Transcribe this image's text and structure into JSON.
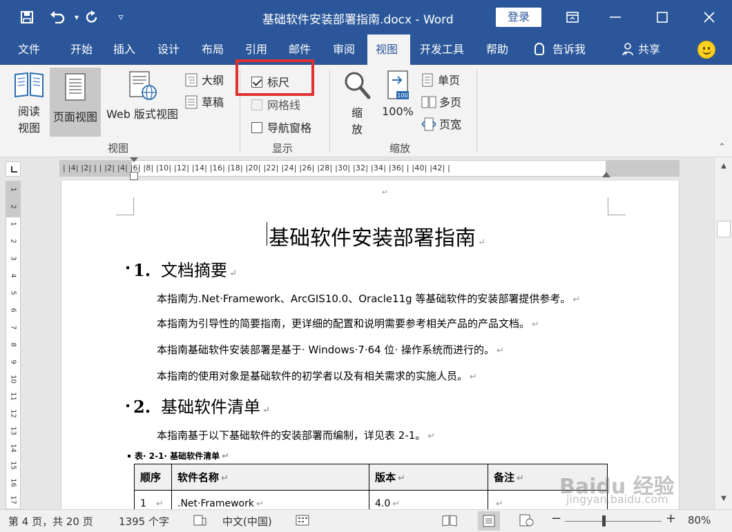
{
  "titlebar": {
    "doc_title": "基础软件安装部署指南.docx  -  Word",
    "login": "登录",
    "save_icon": "save-icon",
    "undo_icon": "undo-icon",
    "redo_icon": "redo-icon",
    "customize_icon": "customize-qat-icon"
  },
  "tabs": [
    {
      "label": "文件"
    },
    {
      "label": "开始"
    },
    {
      "label": "插入"
    },
    {
      "label": "设计"
    },
    {
      "label": "布局"
    },
    {
      "label": "引用"
    },
    {
      "label": "邮件"
    },
    {
      "label": "审阅"
    },
    {
      "label": "视图",
      "active": true
    },
    {
      "label": "开发工具"
    },
    {
      "label": "帮助"
    },
    {
      "label": "告诉我"
    },
    {
      "label": "共享"
    }
  ],
  "ribbon": {
    "view_group": {
      "read_mode": "阅读\n视图",
      "read_mode_l1": "阅读",
      "read_mode_l2": "视图",
      "print_layout": "页面视图",
      "web_layout": "Web 版式视图",
      "outline": "大纲",
      "draft": "草稿",
      "label": "视图"
    },
    "show_group": {
      "ruler": "标尺",
      "gridlines": "网格线",
      "nav_pane": "导航窗格",
      "label": "显示"
    },
    "zoom_group": {
      "zoom_l1": "缩",
      "zoom_l2": "放",
      "zoom_100": "100%",
      "one_page": "单页",
      "multi_page": "多页",
      "page_width": "页宽",
      "label": "缩放"
    }
  },
  "ruler": {
    "top_text": "| |4| |2| | |  |2| |4| |6| |8| |10| |12| |14| |16| |18| |20| |22| |24| |26| |28| |30| |32| |34| |36| |  |40| |42| |",
    "left_numbers": [
      "1",
      "2",
      "1",
      "2",
      "3",
      "4",
      "5",
      "6",
      "7",
      "8",
      "9",
      "10",
      "11",
      "12",
      "13",
      "14",
      "15",
      "16",
      "17"
    ]
  },
  "document": {
    "title": "基础软件安装部署指南",
    "h1_num": "1.",
    "h1_text": "文档摘要",
    "p1": "本指南为.Net·Framework、ArcGIS10.0、Oracle11g 等基础软件的安装部署提供参考。",
    "p2": "本指南为引导性的简要指南，更详细的配置和说明需要参考相关产品的产品文档。",
    "p3": "本指南基础软件安装部署是基于· Windows·7·64 位· 操作系统而进行的。",
    "p4": "本指南的使用对象是基础软件的初学者以及有相关需求的实施人员。",
    "h2_num": "2.",
    "h2_text": "基础软件清单",
    "p5": "本指南基于以下基础软件的安装部署而编制，详见表 2-1。",
    "caption": "表· 2-1· 基础软件清单",
    "para_mark": "↵",
    "table": {
      "headers": [
        "顺序",
        "软件名称",
        "版本",
        "备注"
      ],
      "row1": [
        "1",
        ".Net·Framework",
        "4.0",
        ""
      ]
    }
  },
  "statusbar": {
    "page": "第 4 页，共 20 页",
    "words": "1395 个字",
    "language": "中文(中国)",
    "zoom": "80%"
  },
  "watermark": {
    "main": "Baidu 经验",
    "sub": "jingyan.baidu.com"
  },
  "colors": {
    "word_blue": "#2b579a",
    "highlight_red": "#e03030"
  }
}
